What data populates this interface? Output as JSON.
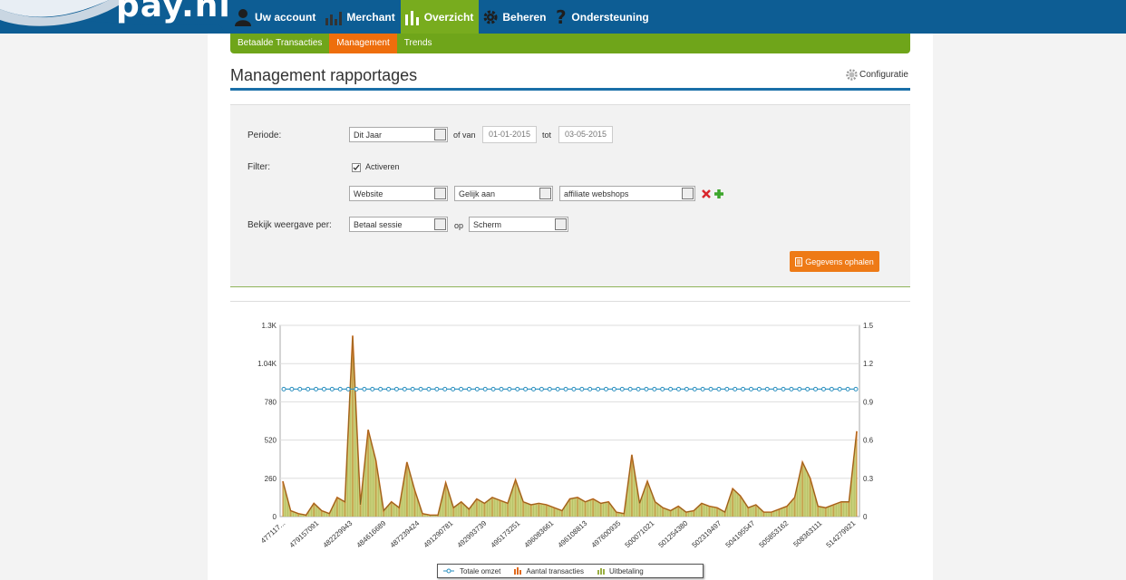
{
  "logo": {
    "text": "pay.nl"
  },
  "nav": [
    {
      "label": "Uw account",
      "icon": "user-icon"
    },
    {
      "label": "Merchant",
      "icon": "merchant-chart-icon"
    },
    {
      "label": "Overzicht",
      "icon": "bar-chart-icon",
      "active": true
    },
    {
      "label": "Beheren",
      "icon": "gear-icon"
    },
    {
      "label": "Ondersteuning",
      "icon": "question-icon"
    }
  ],
  "subnav": [
    {
      "label": "Betaalde Transacties"
    },
    {
      "label": "Management",
      "active": true
    },
    {
      "label": "Trends"
    }
  ],
  "page": {
    "title": "Management rapportages",
    "config_label": "Configuratie"
  },
  "filters": {
    "periode_label": "Periode:",
    "periode_value": "Dit Jaar",
    "of_van": "of van",
    "date_from": "01-01-2015",
    "tot": "tot",
    "date_to": "03-05-2015",
    "filter_label": "Filter:",
    "activeren_label": "Activeren",
    "activeren_checked": true,
    "field_value": "Website",
    "operator_value": "Gelijk aan",
    "filter_value": "affiliate webshops",
    "view_label": "Bekijk weergave per:",
    "view_value": "Betaal sessie",
    "op": "op",
    "output_value": "Scherm",
    "fetch_button": "Gegevens ophalen"
  },
  "chart_data": {
    "type": "area",
    "left_axis_ticks": [
      "0",
      "260",
      "520",
      "780",
      "1.04K",
      "1.3K"
    ],
    "right_axis_ticks": [
      "0",
      "0.3",
      "0.6",
      "0.9",
      "1.2",
      "1.5"
    ],
    "ylim_left": [
      0,
      1300
    ],
    "ylim_right": [
      0,
      1.5
    ],
    "x_tick_labels": [
      "477117...",
      "479157091",
      "482229943",
      "484616689",
      "487239424",
      "491290781",
      "492993739",
      "495173251",
      "496083661",
      "496108813",
      "497600935",
      "500071021",
      "501254380",
      "502319497",
      "504195547",
      "505853162",
      "508363111",
      "514279921"
    ],
    "series": [
      {
        "name": "Totale omzet",
        "axis": "right",
        "color": "#2a8fbf",
        "constant_value": 1.0
      },
      {
        "name": "Aantal transacties",
        "axis": "left",
        "color": "#e0691c",
        "values": [
          240,
          40,
          20,
          10,
          90,
          40,
          20,
          130,
          100,
          1230,
          80,
          590,
          380,
          40,
          100,
          60,
          370,
          180,
          20,
          10,
          10,
          230,
          60,
          100,
          50,
          120,
          90,
          130,
          110,
          90,
          250,
          100,
          80,
          90,
          80,
          60,
          40,
          120,
          130,
          100,
          120,
          90,
          100,
          30,
          20,
          420,
          90,
          240,
          100,
          60,
          40,
          70,
          30,
          40,
          90,
          70,
          60,
          30,
          190,
          140,
          60,
          80,
          30,
          30,
          50,
          70,
          130,
          370,
          260,
          70,
          60,
          80,
          100,
          100,
          580
        ],
        "note": ""
      },
      {
        "name": "Uitbetaling",
        "axis": "left",
        "color": "#b8c46a"
      }
    ],
    "grid": true,
    "legend_position": "bottom"
  }
}
